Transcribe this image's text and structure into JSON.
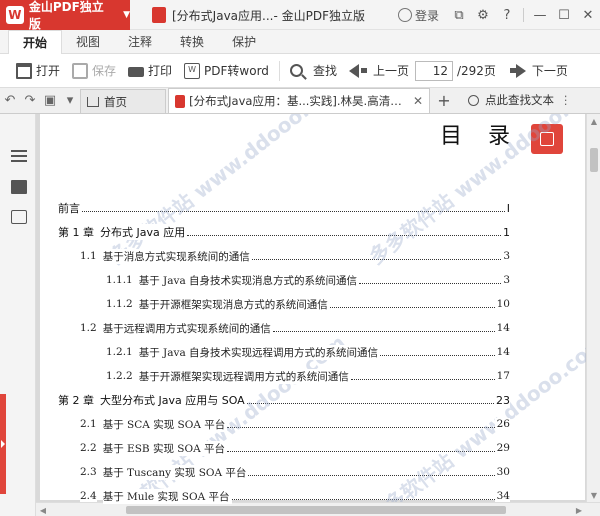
{
  "app": {
    "brand_logo": "W",
    "brand_name": "金山PDF独立版",
    "accent": "#d8372f"
  },
  "window": {
    "doc_title": "[分布式Java应用...- 金山PDF独立版",
    "login_label": "登录",
    "controls": [
      "copy-icon",
      "gear-icon",
      "question-icon",
      "minimize-icon",
      "maximize-icon",
      "close-icon"
    ]
  },
  "menu": {
    "tabs": [
      "开始",
      "视图",
      "注释",
      "转换",
      "保护"
    ],
    "active": "开始"
  },
  "toolbar": {
    "open": "打开",
    "save": "保存",
    "print": "打印",
    "pdf_to_word": "PDF转word",
    "find": "查找",
    "prev_page": "上一页",
    "page_value": "12",
    "page_total": "/292页",
    "next_page": "下一页"
  },
  "tabs": {
    "home": "首页",
    "doc": "[分布式Java应用：基...实践].林昊.高清文字版",
    "find_text": "点此查找文本"
  },
  "document": {
    "heading": "目录",
    "toc": [
      {
        "level": 0,
        "num": "",
        "title": "前言",
        "page": "I"
      },
      {
        "level": 0,
        "num": "第 1 章",
        "title": "分布式 Java 应用",
        "page": "1"
      },
      {
        "level": 1,
        "num": "1.1",
        "title": "基于消息方式实现系统间的通信",
        "page": "3"
      },
      {
        "level": 2,
        "num": "1.1.1",
        "title": "基于 Java 自身技术实现消息方式的系统间通信",
        "page": "3"
      },
      {
        "level": 2,
        "num": "1.1.2",
        "title": "基于开源框架实现消息方式的系统间通信",
        "page": "10"
      },
      {
        "level": 1,
        "num": "1.2",
        "title": "基于远程调用方式实现系统间的通信",
        "page": "14"
      },
      {
        "level": 2,
        "num": "1.2.1",
        "title": "基于 Java 自身技术实现远程调用方式的系统间通信",
        "page": "14"
      },
      {
        "level": 2,
        "num": "1.2.2",
        "title": "基于开源框架实现远程调用方式的系统间通信",
        "page": "17"
      },
      {
        "level": 0,
        "num": "第 2 章",
        "title": "大型分布式 Java 应用与 SOA",
        "page": "23"
      },
      {
        "level": 1,
        "num": "2.1",
        "title": "基于 SCA 实现 SOA 平台",
        "page": "26"
      },
      {
        "level": 1,
        "num": "2.2",
        "title": "基于 ESB 实现 SOA 平台",
        "page": "29"
      },
      {
        "level": 1,
        "num": "2.3",
        "title": "基于 Tuscany 实现 SOA 平台",
        "page": "30"
      },
      {
        "level": 1,
        "num": "2.4",
        "title": "基于 Mule 实现 SOA 平台",
        "page": "34"
      }
    ],
    "watermark": "多多软件站 www.ddooo.com"
  }
}
